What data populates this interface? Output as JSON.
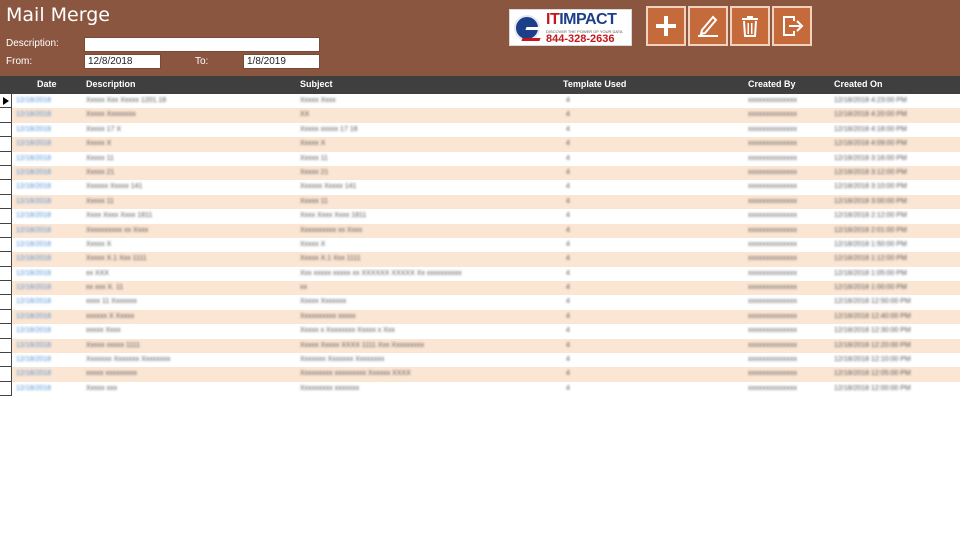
{
  "app": {
    "title": "Mail Merge"
  },
  "filters": {
    "description_label": "Description:",
    "description_value": "",
    "from_label": "From:",
    "from_value": "12/8/2018",
    "to_label": "To:",
    "to_value": "1/8/2019"
  },
  "logo": {
    "brand_it": "IT",
    "brand_impact": "IMPACT",
    "tagline": "DISCOVER THE POWER OF YOUR DATA",
    "phone": "844-328-2636"
  },
  "toolbar": [
    {
      "name": "add-button",
      "icon": "plus-icon"
    },
    {
      "name": "edit-button",
      "icon": "pencil-icon"
    },
    {
      "name": "delete-button",
      "icon": "trash-icon"
    },
    {
      "name": "exit-button",
      "icon": "exit-icon"
    }
  ],
  "colors": {
    "header_bg": "#8b5640",
    "button_bg": "#c56a3a",
    "grid_header_bg": "#3f3f3f",
    "row_alt": "#fbe5d3",
    "date_link": "#4a8fd6"
  },
  "grid": {
    "columns": [
      "Date",
      "Description",
      "Subject",
      "Template Used",
      "Created By",
      "Created On"
    ],
    "rows": [
      [
        "12/18/2018",
        "Xxxxx Xxx Xxxxx 1201.18",
        "Xxxxx Xxxx",
        "4",
        "xxxxxxxxxxxxxx",
        "12/18/2018 4:23:00 PM"
      ],
      [
        "12/18/2018",
        "Xxxxx Xxxxxxxx",
        "XX",
        "4",
        "xxxxxxxxxxxxxx",
        "12/18/2018 4:20:00 PM"
      ],
      [
        "12/18/2018",
        "Xxxxx 17 X",
        "Xxxxx xxxxx 17 18",
        "4",
        "xxxxxxxxxxxxxx",
        "12/18/2018 4:18:00 PM"
      ],
      [
        "12/18/2018",
        "Xxxxx X",
        "Xxxxx X",
        "4",
        "xxxxxxxxxxxxxx",
        "12/18/2018 4:09:00 PM"
      ],
      [
        "12/18/2018",
        "Xxxxx 11",
        "Xxxxx 11",
        "4",
        "xxxxxxxxxxxxxx",
        "12/18/2018 3:16:00 PM"
      ],
      [
        "12/18/2018",
        "Xxxxx 21",
        "Xxxxx 21",
        "4",
        "xxxxxxxxxxxxxx",
        "12/18/2018 3:12:00 PM"
      ],
      [
        "12/18/2018",
        "Xxxxxx Xxxxx 141",
        "Xxxxxx Xxxxx 141",
        "4",
        "xxxxxxxxxxxxxx",
        "12/18/2018 3:10:00 PM"
      ],
      [
        "12/18/2018",
        "Xxxxx 11",
        "Xxxxx 11",
        "4",
        "xxxxxxxxxxxxxx",
        "12/18/2018 3:00:00 PM"
      ],
      [
        "12/18/2018",
        "Xxxx Xxxx Xxxx 1811",
        "Xxxx Xxxx Xxxx 1811",
        "4",
        "xxxxxxxxxxxxxx",
        "12/18/2018 2:12:00 PM"
      ],
      [
        "12/18/2018",
        "Xxxxxxxxxx xx Xxxx",
        "Xxxxxxxxxx xx Xxxx",
        "4",
        "xxxxxxxxxxxxxx",
        "12/18/2018 2:01:00 PM"
      ],
      [
        "12/18/2018",
        "Xxxxx X",
        "Xxxxx X",
        "4",
        "xxxxxxxxxxxxxx",
        "12/18/2018 1:50:00 PM"
      ],
      [
        "12/18/2018",
        "Xxxxx X.1 Xxx 1111",
        "Xxxxx X.1 Xxx 1111",
        "4",
        "xxxxxxxxxxxxxx",
        "12/18/2018 1:12:00 PM"
      ],
      [
        "12/18/2018",
        "xx XXX",
        "Xxx xxxxx xxxxx xx XXXXXX XXXXX Xx xxxxxxxxxx",
        "4",
        "xxxxxxxxxxxxxx",
        "12/18/2018 1:05:00 PM"
      ],
      [
        "12/18/2018",
        "xx xxx X. 11",
        "xx",
        "4",
        "xxxxxxxxxxxxxx",
        "12/18/2018 1:00:00 PM"
      ],
      [
        "12/18/2018",
        "xxxx 11 Xxxxxxx",
        "Xxxxx Xxxxxxx",
        "4",
        "xxxxxxxxxxxxxx",
        "12/18/2018 12:50:00 PM"
      ],
      [
        "12/18/2018",
        "xxxxxx X Xxxxx",
        "Xxxxxxxxxx xxxxx",
        "4",
        "xxxxxxxxxxxxxx",
        "12/18/2018 12:40:00 PM"
      ],
      [
        "12/18/2018",
        "xxxxx Xxxx",
        "Xxxxx x Xxxxxxxx Xxxxx x Xxx",
        "4",
        "xxxxxxxxxxxxxx",
        "12/18/2018 12:30:00 PM"
      ],
      [
        "12/18/2018",
        "Xxxxx xxxxx 1111",
        "Xxxxx Xxxxx XXXX 1111 Xxx Xxxxxxxxx",
        "4",
        "xxxxxxxxxxxxxx",
        "12/18/2018 12:20:00 PM"
      ],
      [
        "12/18/2018",
        "Xxxxxxx Xxxxxxx Xxxxxxxx",
        "Xxxxxxx Xxxxxxx Xxxxxxxx",
        "4",
        "xxxxxxxxxxxxxx",
        "12/18/2018 12:10:00 PM"
      ],
      [
        "12/18/2018",
        "xxxxx xxxxxxxxx",
        "Xxxxxxxxx xxxxxxxxx Xxxxxx XXXX",
        "4",
        "xxxxxxxxxxxxxx",
        "12/18/2018 12:05:00 PM"
      ],
      [
        "12/18/2018",
        "Xxxxx xxx",
        "Xxxxxxxxx xxxxxxx",
        "4",
        "xxxxxxxxxxxxxx",
        "12/18/2018 12:00:00 PM"
      ]
    ]
  }
}
